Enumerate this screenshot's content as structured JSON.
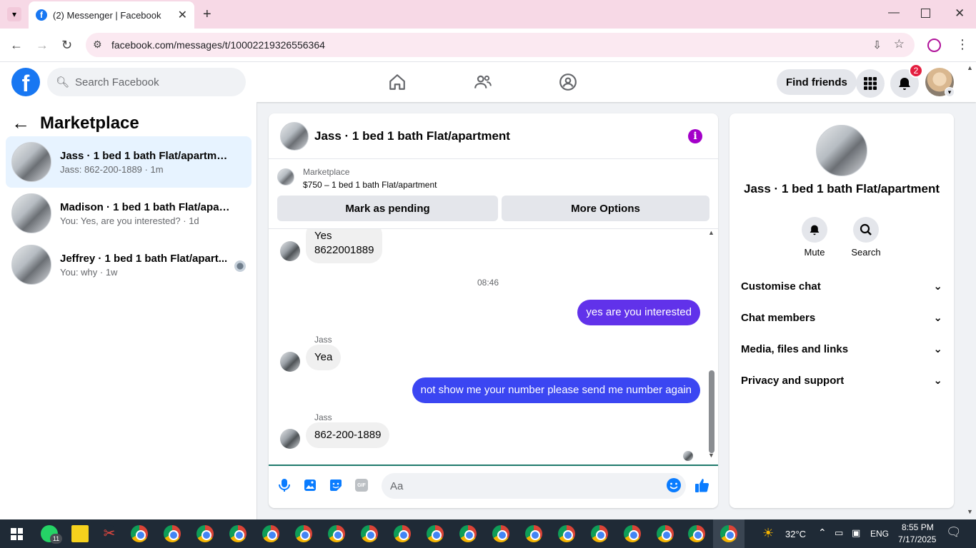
{
  "browser": {
    "tab_title": "(2) Messenger | Facebook",
    "url": "facebook.com/messages/t/10002219326556364"
  },
  "fb_header": {
    "search_placeholder": "Search Facebook",
    "find_friends_label": "Find friends",
    "notifications_count": "2"
  },
  "left": {
    "title": "Marketplace",
    "conversations": [
      {
        "title": "Jass · 1 bed 1 bath Flat/apartment",
        "subtitle": "Jass: 862-200-1889 · 1m"
      },
      {
        "title": "Madison · 1 bed 1 bath Flat/apart...",
        "subtitle": "You: Yes, are you interested? · 1d"
      },
      {
        "title": "Jeffrey · 1 bed 1 bath Flat/apart...",
        "subtitle": "You: why · 1w"
      }
    ]
  },
  "chat": {
    "title": "Jass · 1 bed 1 bath Flat/apartment",
    "marketplace_label": "Marketplace",
    "listing": "$750 – 1 bed 1 bath Flat/apartment",
    "mark_pending_label": "Mark as pending",
    "more_options_label": "More Options",
    "messages": {
      "m1": "Yes\n8622001889",
      "time": "08:46",
      "m2": "yes are you interested",
      "sender1": "Jass",
      "m3": "Yea",
      "m4": "not show me your number please send me number again",
      "sender2": "Jass",
      "m5": "862-200-1889"
    },
    "input_placeholder": "Aa"
  },
  "right": {
    "title": "Jass · 1 bed 1 bath Flat/apartment",
    "mute_label": "Mute",
    "search_label": "Search",
    "sections": [
      "Customise chat",
      "Chat members",
      "Media, files and links",
      "Privacy and support"
    ]
  },
  "taskbar": {
    "whatsapp_badge": "11",
    "temperature": "32°C",
    "language": "ENG",
    "time": "8:55 PM",
    "date": "7/17/2025"
  },
  "colors": {
    "fb_blue": "#1877f2",
    "outgoing_bubble": "#6132ea",
    "outgoing_bubble_2": "#3b46f2",
    "info_icon": "#a300c9",
    "notification_red": "#e41e3f"
  }
}
